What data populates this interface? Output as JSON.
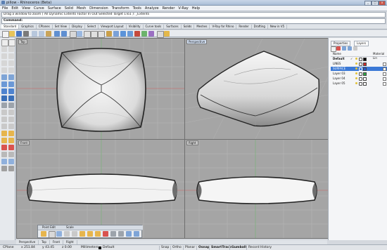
{
  "window": {
    "title": "pillow - Rhinoceros (Beta)",
    "minimize_label": "_",
    "maximize_label": "□",
    "close_label": "x"
  },
  "menu": [
    "File",
    "Edit",
    "View",
    "Curve",
    "Surface",
    "Solid",
    "Mesh",
    "Dimension",
    "Transform",
    "Tools",
    "Analyze",
    "Render",
    "V-Ray",
    "Help"
  ],
  "command": {
    "history": "Drag a window to zoom ( All  Dynamic  Extents  Factor  In  Out  Selected  Target  1To1 ): _Extents",
    "prompt_label": "Command:",
    "value": ""
  },
  "toolbar_tabs": [
    "Standard",
    "Graphics",
    "CPlanes",
    "Set View",
    "Display",
    "Select",
    "Viewport Layout",
    "Visibility",
    "Curve tools",
    "Surfaces",
    "Solids",
    "Meshes",
    "V-Ray for Rhino",
    "Render",
    "Drafting",
    "New in V5"
  ],
  "viewports": {
    "top": "Top",
    "perspective": "Perspective",
    "front": "Front",
    "right": "Right"
  },
  "viewport_tabs": [
    "Perspective",
    "Top",
    "Front",
    "Right"
  ],
  "float_panel": {
    "tabs": [
      "Point Edit",
      "Scale"
    ]
  },
  "right_panel": {
    "tabs": [
      "Properties",
      "Layers"
    ],
    "header_name": "Name",
    "header_material": "Material Lin",
    "layers": [
      {
        "name": "Default",
        "current": "✓",
        "color": "#000000"
      },
      {
        "name": "LINES",
        "current": "",
        "color": "#d22b2b"
      },
      {
        "name": "SURFACE",
        "current": "",
        "color": "#2a5bd7"
      },
      {
        "name": "Layer 03",
        "current": "",
        "color": "#2fa845"
      },
      {
        "name": "Layer 04",
        "current": "",
        "color": "#ffffff"
      },
      {
        "name": "Layer 05",
        "current": "",
        "color": "#ffffff"
      }
    ]
  },
  "status": {
    "cplane": "CPlane",
    "x": "x 251.84",
    "y": "y 43.45",
    "z": "z 0.00",
    "units": "Millimeters",
    "layer": "Default",
    "buttons": [
      {
        "label": "Snap",
        "on": false
      },
      {
        "label": "Ortho",
        "on": false
      },
      {
        "label": "Planar",
        "on": false
      },
      {
        "label": "Osnap",
        "on": true
      },
      {
        "label": "SmartTrack",
        "on": true
      },
      {
        "label": "Gumball",
        "on": true
      },
      {
        "label": "Record History",
        "on": false
      }
    ]
  }
}
